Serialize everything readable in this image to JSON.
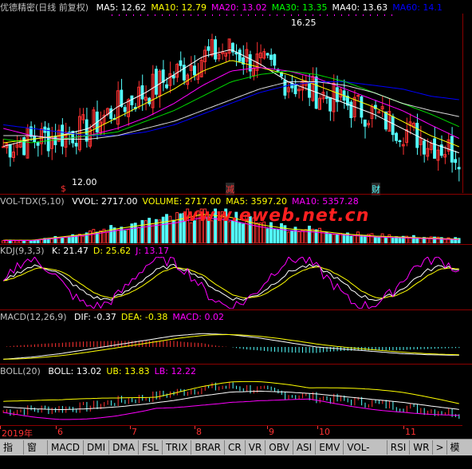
{
  "main": {
    "title": "优德精密(日线 前复权)",
    "indicators": [
      {
        "name": "MA5",
        "value": "12.62",
        "color": "#ffffff"
      },
      {
        "name": "MA10",
        "value": "12.79",
        "color": "#ffff00"
      },
      {
        "name": "MA20",
        "value": "13.02",
        "color": "#ff00ff"
      },
      {
        "name": "MA30",
        "value": "13.35",
        "color": "#00ff00"
      },
      {
        "name": "MA40",
        "value": "13.63",
        "color": "#ffffff"
      },
      {
        "name": "MA60",
        "value": "14.1",
        "color": "#0000ff"
      }
    ],
    "high_label": "16.25",
    "low_label": "12.00",
    "event_labels": [
      "$",
      "减",
      "财"
    ]
  },
  "vol": {
    "title": "VOL-TDX(5,10)",
    "items": [
      {
        "name": "VVOL",
        "value": "2717.00",
        "color": "#ffffff"
      },
      {
        "name": "VOLUME",
        "value": "2717.00",
        "color": "#ffff00"
      },
      {
        "name": "MA5",
        "value": "3597.20",
        "color": "#ffff00"
      },
      {
        "name": "MA10",
        "value": "5357.28",
        "color": "#ff00ff"
      }
    ],
    "watermark": "www.eweb.net.cn"
  },
  "kdj": {
    "title": "KDJ(9,3,3)",
    "items": [
      {
        "name": "K",
        "value": "21.47",
        "color": "#ffffff"
      },
      {
        "name": "D",
        "value": "25.62",
        "color": "#ffff00"
      },
      {
        "name": "J",
        "value": "13.17",
        "color": "#ff00ff"
      }
    ]
  },
  "macd": {
    "title": "MACD(12,26,9)",
    "items": [
      {
        "name": "DIF",
        "value": "-0.37",
        "color": "#ffffff"
      },
      {
        "name": "DEA",
        "value": "-0.38",
        "color": "#ffff00"
      },
      {
        "name": "MACD",
        "value": "0.02",
        "color": "#ff00ff"
      }
    ]
  },
  "boll": {
    "title": "BOLL(20)",
    "items": [
      {
        "name": "BOLL",
        "value": "13.02",
        "color": "#ffffff"
      },
      {
        "name": "UB",
        "value": "13.83",
        "color": "#ffff00"
      },
      {
        "name": "LB",
        "value": "12.22",
        "color": "#ff00ff"
      }
    ]
  },
  "dates": [
    "2019年",
    "6",
    "7",
    "8",
    "9",
    "10",
    "11"
  ],
  "tabs": [
    "指标",
    "窗口",
    "MACD",
    "DMI",
    "DMA",
    "FSL",
    "TRIX",
    "BRAR",
    "CR",
    "VR",
    "OBV",
    "ASI",
    "EMV",
    "VOL-TDX",
    "RSI",
    "WR"
  ],
  "tab_more": ">",
  "template_label": "模板",
  "colors": {
    "up": "#ff3232",
    "down": "#54ffff",
    "grid": "#8b0000",
    "text_title": "#c0c0c0"
  },
  "chart_data": [
    {
      "type": "line",
      "title": "优德精密(日线 前复权)",
      "series": [
        {
          "name": "MA5",
          "values": [
            12.8,
            13.0,
            13.1,
            13.3,
            13.9,
            14.3,
            14.8,
            15.3,
            15.5,
            15.1,
            14.6,
            14.3,
            14.0,
            13.7,
            13.3,
            12.9,
            12.62
          ]
        },
        {
          "name": "MA10",
          "values": [
            12.9,
            13.0,
            13.1,
            13.2,
            13.6,
            14.0,
            14.4,
            14.9,
            15.2,
            15.0,
            14.8,
            14.5,
            14.2,
            13.9,
            13.5,
            13.1,
            12.79
          ]
        },
        {
          "name": "MA20",
          "values": [
            13.3,
            13.1,
            13.0,
            13.1,
            13.3,
            13.6,
            14.0,
            14.5,
            14.9,
            15.0,
            14.9,
            14.7,
            14.4,
            14.1,
            13.8,
            13.4,
            13.02
          ]
        },
        {
          "name": "MA60",
          "values": [
            13.4,
            13.3,
            13.2,
            13.1,
            13.1,
            13.2,
            13.4,
            13.7,
            14.0,
            14.3,
            14.5,
            14.6,
            14.6,
            14.5,
            14.4,
            14.2,
            14.1
          ]
        }
      ],
      "ylim": [
        11.5,
        16.5
      ]
    }
  ]
}
